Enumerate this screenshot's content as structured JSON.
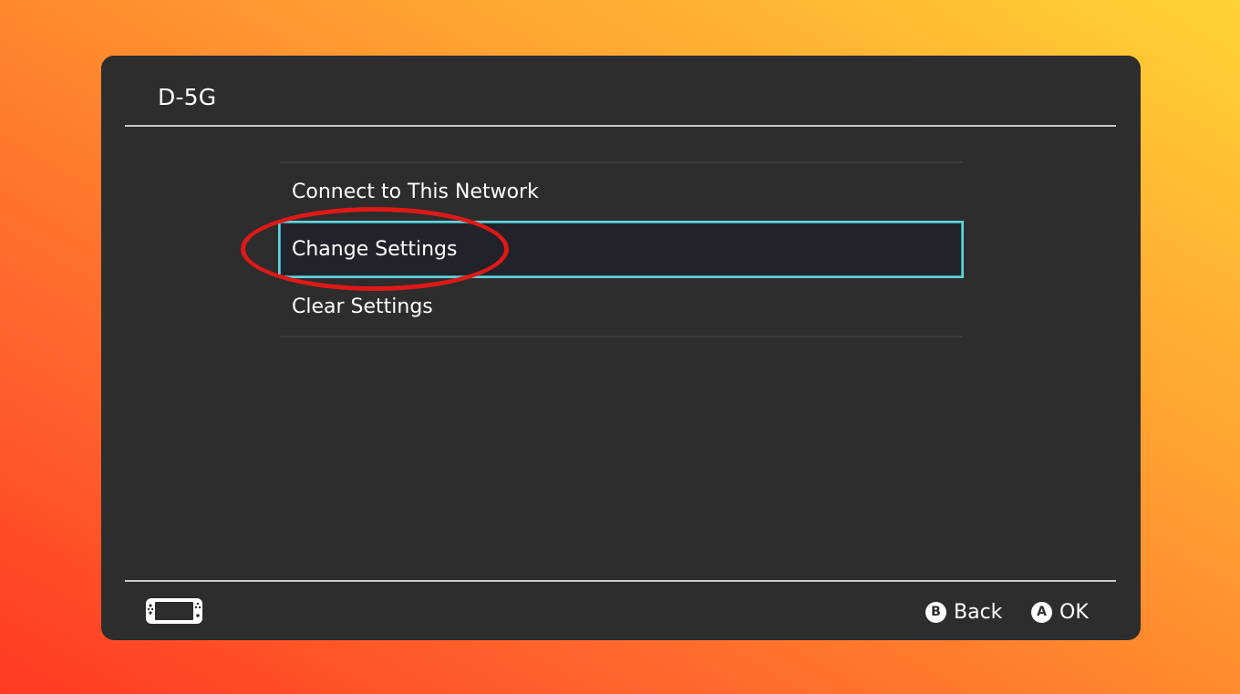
{
  "header": {
    "title": "D-5G"
  },
  "menu": {
    "items": [
      {
        "label": "Connect to This Network",
        "selected": false
      },
      {
        "label": "Change Settings",
        "selected": true
      },
      {
        "label": "Clear Settings",
        "selected": false
      }
    ]
  },
  "footer": {
    "console_icon": "handheld-console-icon",
    "back": {
      "button_glyph": "B",
      "label": "Back"
    },
    "ok": {
      "button_glyph": "A",
      "label": "OK"
    }
  },
  "colors": {
    "selection_border": "#63d2dc",
    "annotation_ring": "#e01818",
    "panel_background": "#2d2d2d"
  }
}
